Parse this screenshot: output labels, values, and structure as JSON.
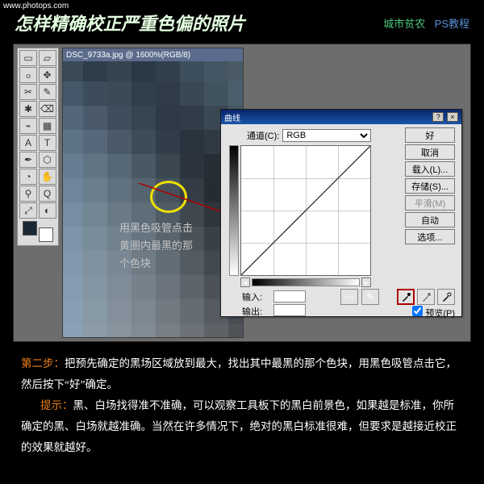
{
  "url": "www.photops.com",
  "title": "怎样精确校正严重色偏的照片",
  "links": {
    "author": "城市贫农",
    "tutorial": "PS教程"
  },
  "toolbox": [
    "▭",
    "▱",
    "ჿ",
    "✥",
    "✂",
    "✎",
    "✱",
    "⌫",
    "⌁",
    "▦",
    "A",
    "T",
    "✒",
    "⬡",
    "◔",
    "✋",
    "⚲",
    "Q",
    "⤢",
    "◐"
  ],
  "canvas": {
    "title": "DSC_9733a.jpg @ 1600%(RGB/8)",
    "hint1": "用黑色吸管点击",
    "hint2": "黄圈内最黑的那",
    "hint3": "个色块"
  },
  "curves": {
    "title": "曲线",
    "channel_label": "通道(C):",
    "channel_value": "RGB",
    "buttons": {
      "ok": "好",
      "cancel": "取消",
      "load": "载入(L)...",
      "save": "存储(S)...",
      "smooth": "平滑(M)",
      "auto": "自动",
      "opts": "选项..."
    },
    "input_label": "输入:",
    "output_label": "输出:",
    "preview_label": "预览(P)"
  },
  "text": {
    "step_label": "第二步：",
    "step_body": "把预先确定的黑场区域放到最大，找出其中最黑的那个色块，用黑色吸管点击它，然后按下“好”确定。",
    "hint_label": "提示：",
    "hint_body": "黑、白场找得准不准确，可以观察工具板下的黑白前景色，如果越是标准，你所确定的黑、白场就越准确。当然在许多情况下，绝对的黑白标准很难，但要求是越接近校正的效果就越好。"
  },
  "pixels": [
    [
      "#3a4b57",
      "#2e3d4a",
      "#344550",
      "#2a3946",
      "#32404e",
      "#3d4f5c",
      "#455664",
      "#4a5b67"
    ],
    [
      "#45586a",
      "#3c4c5b",
      "#3a4a56",
      "#2f3f4b",
      "#303d49",
      "#394854",
      "#425360",
      "#4c5e6b"
    ],
    [
      "#54677a",
      "#4a5a6a",
      "#3f4e5c",
      "#364552",
      "#2e3a46",
      "#303c47",
      "#3a4854",
      "#475865"
    ],
    [
      "#5e7386",
      "#566879",
      "#4a5a68",
      "#3e4c59",
      "#313d48",
      "#2a343e",
      "#303a44",
      "#3d4b57"
    ],
    [
      "#677d91",
      "#607484",
      "#566875",
      "#495865",
      "#3a4650",
      "#2c353e",
      "#262e35",
      "#313b44"
    ],
    [
      "#6f8599",
      "#6a7e8e",
      "#60727f",
      "#55656f",
      "#45525c",
      "#343d45",
      "#252c32",
      "#2a323a"
    ],
    [
      "#768da2",
      "#728694",
      "#697a86",
      "#5e6d78",
      "#505c65",
      "#3f484f",
      "#2e353b",
      "#272d34"
    ],
    [
      "#7c93a8",
      "#798c9a",
      "#71818d",
      "#677580",
      "#5a656e",
      "#4a535a",
      "#394046",
      "#2d333a"
    ],
    [
      "#8197ac",
      "#7f919f",
      "#788793",
      "#6f7c86",
      "#636d76",
      "#545c63",
      "#42494f",
      "#343a40"
    ],
    [
      "#859bb0",
      "#8495a3",
      "#7e8c97",
      "#76828b",
      "#6b747c",
      "#5d646b",
      "#4c5258",
      "#3e4449"
    ],
    [
      "#889eb3",
      "#8899a6",
      "#83909b",
      "#7c8790",
      "#727a81",
      "#656c72",
      "#555b60",
      "#474c51"
    ],
    [
      "#8aa0b5",
      "#8b9ba8",
      "#87939d",
      "#818b93",
      "#787f86",
      "#6c7278",
      "#5d6267",
      "#505459"
    ]
  ]
}
